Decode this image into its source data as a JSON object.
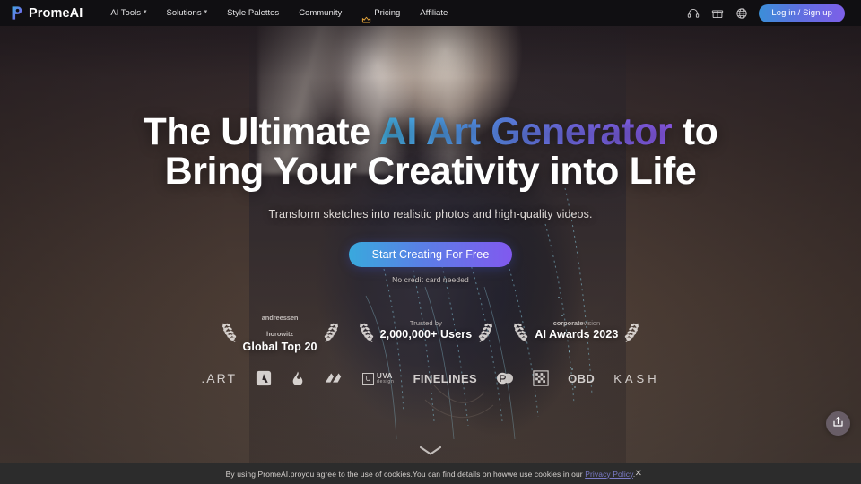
{
  "brand": {
    "name": "PromeAI",
    "logo_icon": "promeai-p-mark"
  },
  "nav": {
    "links": [
      {
        "label": "AI Tools",
        "has_dropdown": true
      },
      {
        "label": "Solutions",
        "has_dropdown": true
      },
      {
        "label": "Style Palettes",
        "has_dropdown": false
      },
      {
        "label": "Community",
        "has_dropdown": false
      },
      {
        "label": "Pricing",
        "has_dropdown": false,
        "icon": "crown-icon"
      },
      {
        "label": "Affiliate",
        "has_dropdown": false
      }
    ],
    "icons": [
      {
        "name": "headset-icon"
      },
      {
        "name": "gift-icon"
      },
      {
        "name": "globe-icon"
      }
    ],
    "login_button": "Log in / Sign up"
  },
  "hero": {
    "headline_part1": "The Ultimate ",
    "headline_gradient": "AI Art Generator",
    "headline_part2": " to",
    "headline_line2": "Bring Your Creativity into Life",
    "subheading": "Transform sketches into realistic photos and high-quality videos.",
    "cta_button": "Start Creating For Free",
    "cta_note": "No credit card needed",
    "scroll_cue_icon": "chevron-down-icon"
  },
  "badges": [
    {
      "top_line": "andreessen",
      "top_line_2": "horowitz",
      "main": "Global Top 20",
      "style": "brand"
    },
    {
      "top_line": "Trusted by",
      "top_line_2": "",
      "main": "2,000,000+ Users",
      "style": "plain"
    },
    {
      "top_line": "corporate",
      "top_line_2": "vision",
      "main": "AI Awards 2023",
      "style": "brand"
    }
  ],
  "partners": [
    {
      "name": ".ART",
      "type": "text-spaced"
    },
    {
      "name": "adobe-triangle-logo",
      "type": "icon"
    },
    {
      "name": "flame-logo",
      "type": "icon"
    },
    {
      "name": "brushstroke-logo",
      "type": "icon"
    },
    {
      "name": "UVA",
      "sub": "design",
      "type": "uva"
    },
    {
      "name": "FINELINES",
      "type": "text-bold"
    },
    {
      "name": "circle-rp-logo",
      "type": "icon"
    },
    {
      "name": "pixel-grid-logo",
      "type": "icon"
    },
    {
      "name": "OBD",
      "type": "text-bold"
    },
    {
      "name": "KASH",
      "type": "text-thin"
    }
  ],
  "share": {
    "icon": "share-icon"
  },
  "cookie": {
    "text": "By using PromeAI.proyou agree to the use of cookies.You can find details on howwe use cookies in our ",
    "link": "Privacy Policy",
    "period": ".",
    "close_icon": "close-icon"
  },
  "colors": {
    "accent_cyan": "#39a9dd",
    "accent_purple": "#8159ef",
    "nav_bg": "#100f12",
    "cookie_bg": "#2c2c2c",
    "link": "#7b7bc8"
  }
}
